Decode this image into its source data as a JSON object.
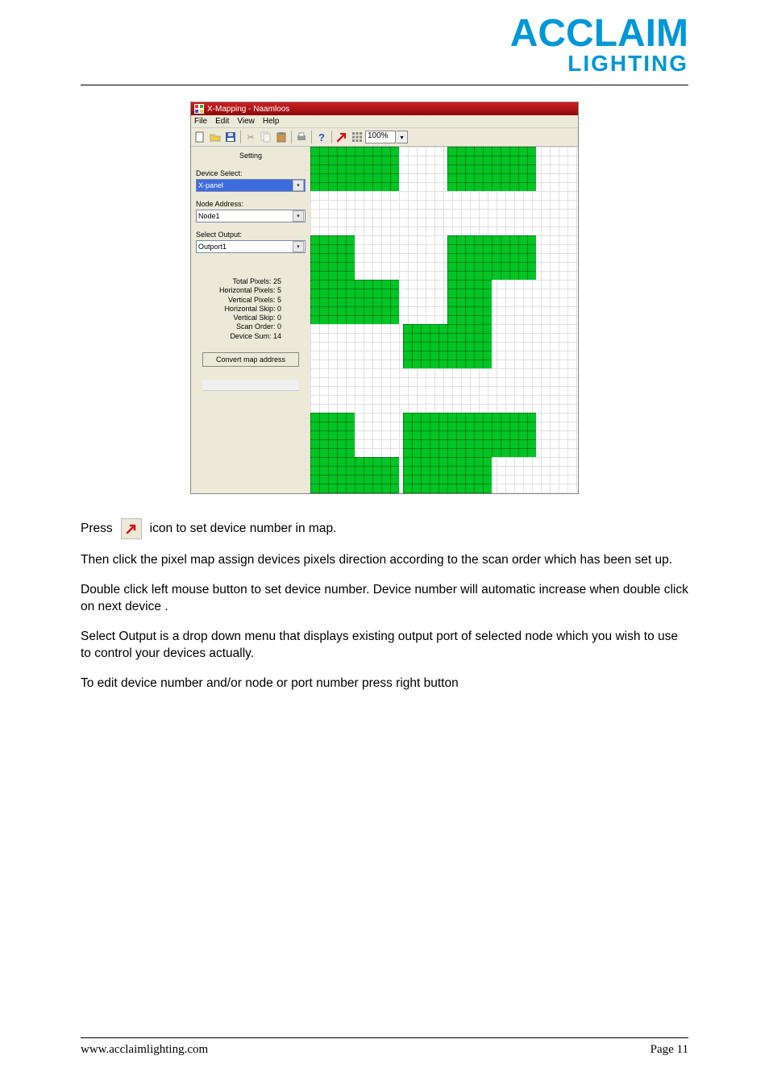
{
  "logo": {
    "main": "ACCLAIM",
    "sub": "LIGHTING"
  },
  "app": {
    "title": "X-Mapping - Naamloos",
    "menus": [
      "File",
      "Edit",
      "View",
      "Help"
    ],
    "toolbar": {
      "zoom_value": "100%",
      "icons": {
        "new": "new-icon",
        "open": "open-icon",
        "save": "save-icon",
        "cut": "cut-icon",
        "copy": "copy-icon",
        "paste": "paste-icon",
        "print": "print-icon",
        "help": "help-icon",
        "arrow": "arrow-icon",
        "grid": "grid-icon"
      }
    },
    "sidebar": {
      "heading": "Setting",
      "device_select_label": "Device Select:",
      "device_select_value": "X-panel",
      "node_address_label": "Node Address:",
      "node_address_value": "Node1",
      "select_output_label": "Select Output:",
      "select_output_value": "Outport1",
      "stats": {
        "total_pixels_label": "Total Pixels:",
        "total_pixels_value": "25",
        "h_pixels_label": "Horizontal Pixels:",
        "h_pixels_value": "5",
        "v_pixels_label": "Vertical Pixels:",
        "v_pixels_value": "5",
        "h_skip_label": "Horizontal Skip:",
        "h_skip_value": "0",
        "v_skip_label": "Vertical Skip:",
        "v_skip_value": "0",
        "scan_order_label": "Scan Order:",
        "scan_order_value": "0",
        "device_sum_label": "Device Sum:",
        "device_sum_value": "14"
      },
      "convert_btn": "Convert map address"
    }
  },
  "body": {
    "press": "Press",
    "press_rest": "icon to set device number in map.",
    "p2": "Then click the pixel map assign devices pixels direction according to the scan order which has been set up.",
    "p3": "Double click left mouse button to set device number. Device number will automatic increase when  double click on next device .",
    "p4": "Select Output is a drop down menu that displays existing output port of selected node which you wish to use to control your devices actually.",
    "p5": "To edit device number and/or node or port number press right button"
  },
  "footer": {
    "url": "www.acclaimlighting.com",
    "page": "Page 11"
  },
  "devices": [
    {
      "col": 0,
      "row": 0
    },
    {
      "col": 1,
      "row": 0
    },
    {
      "col": 3,
      "row": 0
    },
    {
      "col": 4,
      "row": 0
    },
    {
      "col": 0,
      "row": 2
    },
    {
      "col": 3,
      "row": 2
    },
    {
      "col": 4,
      "row": 2
    },
    {
      "col": 0,
      "row": 3
    },
    {
      "col": 1,
      "row": 3
    },
    {
      "col": 3,
      "row": 3
    },
    {
      "col": 2,
      "row": 4
    },
    {
      "col": 3,
      "row": 4
    },
    {
      "col": 0,
      "row": 6
    },
    {
      "col": 2,
      "row": 6
    },
    {
      "col": 3,
      "row": 6
    },
    {
      "col": 4,
      "row": 6
    },
    {
      "col": 0,
      "row": 7
    },
    {
      "col": 1,
      "row": 7
    },
    {
      "col": 2,
      "row": 7
    },
    {
      "col": 3,
      "row": 7
    }
  ]
}
